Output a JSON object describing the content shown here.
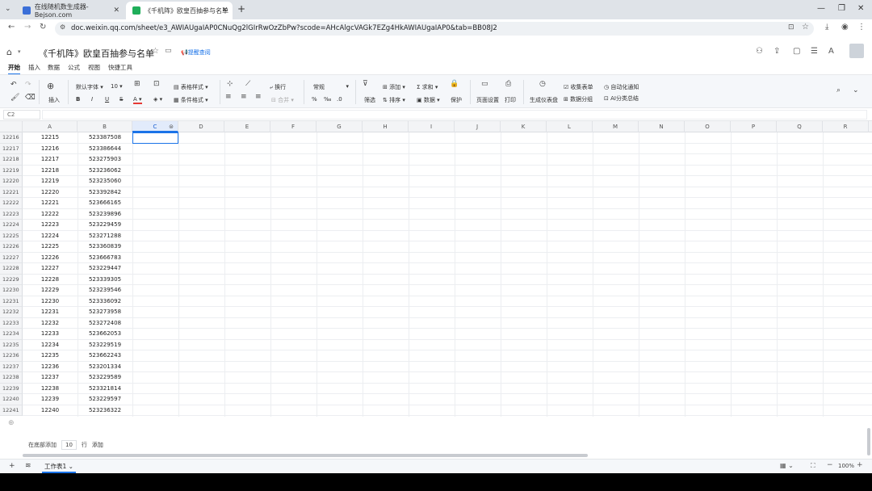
{
  "browser": {
    "tabs": [
      {
        "title": "在线随机数生成器-Bejson.com",
        "active": false,
        "color": "#3b6fd8"
      },
      {
        "title": "《千机阵》欧皇百抽参与名单",
        "active": true,
        "color": "#1fae5a"
      }
    ],
    "new_tab": "+",
    "url": "doc.weixin.qq.com/sheet/e3_AWIAUgaIAP0CNuQg2lGIrRwOzZbPw?scode=AHcAlgcVAGk7EZg4HkAWIAUgaIAP0&tab=BB08J2"
  },
  "doc": {
    "title": "《千机阵》欧皇百抽参与名单",
    "remind_link": "提醒查阅",
    "menu": [
      "开始",
      "插入",
      "数据",
      "公式",
      "视图",
      "快捷工具"
    ]
  },
  "toolbar": {
    "insert": "插入",
    "font": "默认字体",
    "font_size": "10",
    "table_style": "表格样式",
    "cond_format": "条件格式",
    "wrap": "换行",
    "merge": "合并",
    "number_format": "常规",
    "percent": "%",
    "thousands": "‰",
    "decimal": ".0",
    "filter": "筛选",
    "add": "添加",
    "sort": "排序",
    "sum": "求和",
    "data": "数据",
    "protect": "保护",
    "page_setup": "页面设置",
    "print": "打印",
    "dashboard": "生成仪表盘",
    "collect_form": "收集表单",
    "data_group": "数据分组",
    "auto_notify": "自动化通知",
    "ai_summary": "AI分类总结"
  },
  "name_box": "C2",
  "columns": [
    "A",
    "B",
    "C",
    "D",
    "E",
    "F",
    "G",
    "H",
    "I",
    "J",
    "K",
    "L",
    "M",
    "N",
    "O",
    "P",
    "Q",
    "R"
  ],
  "rows": [
    {
      "n": "12216",
      "a": "12215",
      "b": "523387508"
    },
    {
      "n": "12217",
      "a": "12216",
      "b": "523386644"
    },
    {
      "n": "12218",
      "a": "12217",
      "b": "523275903"
    },
    {
      "n": "12219",
      "a": "12218",
      "b": "523236062"
    },
    {
      "n": "12220",
      "a": "12219",
      "b": "523235060"
    },
    {
      "n": "12221",
      "a": "12220",
      "b": "523392842"
    },
    {
      "n": "12222",
      "a": "12221",
      "b": "523666165"
    },
    {
      "n": "12223",
      "a": "12222",
      "b": "523239896"
    },
    {
      "n": "12224",
      "a": "12223",
      "b": "523229459"
    },
    {
      "n": "12225",
      "a": "12224",
      "b": "523271288"
    },
    {
      "n": "12226",
      "a": "12225",
      "b": "523360839"
    },
    {
      "n": "12227",
      "a": "12226",
      "b": "523666783"
    },
    {
      "n": "12228",
      "a": "12227",
      "b": "523229447"
    },
    {
      "n": "12229",
      "a": "12228",
      "b": "523339305"
    },
    {
      "n": "12230",
      "a": "12229",
      "b": "523239546"
    },
    {
      "n": "12231",
      "a": "12230",
      "b": "523336092"
    },
    {
      "n": "12232",
      "a": "12231",
      "b": "523273958"
    },
    {
      "n": "12233",
      "a": "12232",
      "b": "523272408"
    },
    {
      "n": "12234",
      "a": "12233",
      "b": "523662053"
    },
    {
      "n": "12235",
      "a": "12234",
      "b": "523229519"
    },
    {
      "n": "12236",
      "a": "12235",
      "b": "523662243"
    },
    {
      "n": "12237",
      "a": "12236",
      "b": "523201334"
    },
    {
      "n": "12238",
      "a": "12237",
      "b": "523229589"
    },
    {
      "n": "12239",
      "a": "12238",
      "b": "523321814"
    },
    {
      "n": "12240",
      "a": "12239",
      "b": "523229597"
    },
    {
      "n": "12241",
      "a": "12240",
      "b": "523236322"
    }
  ],
  "add_rows": {
    "prefix": "在底部添加",
    "count": "10",
    "unit": "行",
    "button": "添加"
  },
  "sheet": {
    "tab": "工作表1",
    "zoom": "100%"
  },
  "colors": {
    "accent": "#1a73e8",
    "header_bg": "#f3f4f6"
  }
}
